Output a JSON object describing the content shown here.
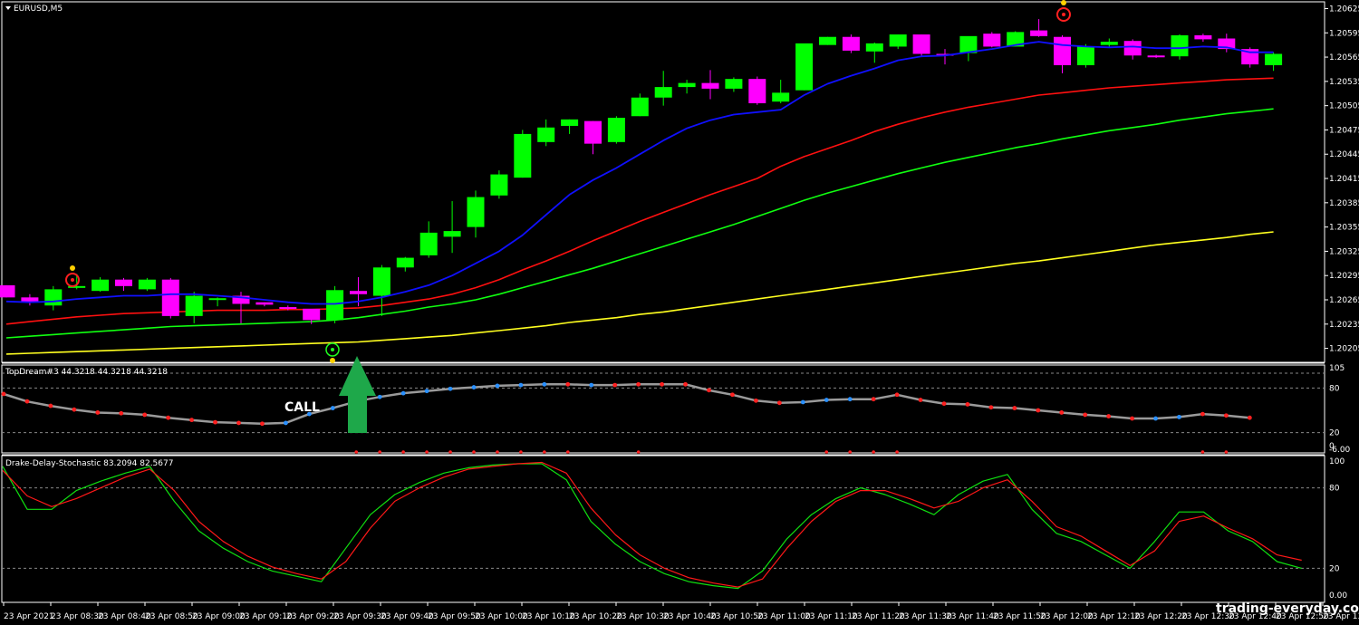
{
  "chart_title": "EURUSD,M5",
  "topdream_label": "TopDream#3 44.3218 44.3218 44.3218",
  "stoch_label": "Drake-Delay-Stochastic 83.2094 82.5677",
  "call_label": "CALL",
  "watermark": "trading-everyday.com",
  "colors": {
    "background": "#000000",
    "bull": "#00ff00",
    "bear": "#ff00ff",
    "ema_blue": "#1010ff",
    "ema_red": "#ff1010",
    "ema_green": "#10ff10",
    "ema_yellow": "#ffff20",
    "arrow": "#1ea84a",
    "dream_line": "#9a9a9a",
    "dot_red": "#ff2020",
    "dot_blue": "#2a90ff",
    "stoch_green": "#10e010",
    "stoch_red": "#ff1818"
  },
  "chart_data": [
    {
      "type": "candlestick",
      "title": "EURUSD,M5",
      "ylim": [
        1.2019,
        1.2063
      ],
      "y_ticks": [
        "1.20625",
        "1.20595",
        "1.20565",
        "1.20535",
        "1.20505",
        "1.20475",
        "1.20445",
        "1.20415",
        "1.20385",
        "1.20355",
        "1.20325",
        "1.20295",
        "1.20265",
        "1.20235",
        "1.20205"
      ],
      "x_ticks": [
        "23 Apr 2021",
        "23 Apr 08:30",
        "23 Apr 08:40",
        "23 Apr 08:50",
        "23 Apr 09:00",
        "23 Apr 09:10",
        "23 Apr 09:20",
        "23 Apr 09:30",
        "23 Apr 09:40",
        "23 Apr 09:50",
        "23 Apr 10:00",
        "23 Apr 10:10",
        "23 Apr 10:20",
        "23 Apr 10:30",
        "23 Apr 10:40",
        "23 Apr 10:50",
        "23 Apr 11:00",
        "23 Apr 11:10",
        "23 Apr 11:20",
        "23 Apr 11:30",
        "23 Apr 11:40",
        "23 Apr 11:50",
        "23 Apr 12:00",
        "23 Apr 12:10",
        "23 Apr 12:20",
        "23 Apr 12:30",
        "23 Apr 12:40",
        "23 Apr 12:50",
        "23 Apr 13:00"
      ],
      "candles": [
        [
          1.20283,
          1.20283,
          1.20268,
          1.20268
        ],
        [
          1.20268,
          1.20272,
          1.20258,
          1.20262
        ],
        [
          1.20258,
          1.20282,
          1.20252,
          1.20278
        ],
        [
          1.2028,
          1.20297,
          1.20278,
          1.20282
        ],
        [
          1.20276,
          1.20293,
          1.20275,
          1.2029
        ],
        [
          1.2029,
          1.20292,
          1.20276,
          1.20282
        ],
        [
          1.20278,
          1.20292,
          1.20276,
          1.2029
        ],
        [
          1.2029,
          1.20292,
          1.20242,
          1.20245
        ],
        [
          1.20245,
          1.20275,
          1.20236,
          1.2027
        ],
        [
          1.20265,
          1.20268,
          1.20257,
          1.20267
        ],
        [
          1.2027,
          1.20275,
          1.20236,
          1.2026
        ],
        [
          1.20262,
          1.20262,
          1.20257,
          1.20259
        ],
        [
          1.20256,
          1.20258,
          1.20252,
          1.20255
        ],
        [
          1.20254,
          1.20252,
          1.20235,
          1.2024
        ],
        [
          1.2024,
          1.20282,
          1.20236,
          1.20277
        ],
        [
          1.20276,
          1.20293,
          1.20257,
          1.20272
        ],
        [
          1.2027,
          1.20308,
          1.20245,
          1.20305
        ],
        [
          1.20305,
          1.20318,
          1.203,
          1.20317
        ],
        [
          1.2032,
          1.20362,
          1.20317,
          1.20348
        ],
        [
          1.20343,
          1.20387,
          1.20323,
          1.2035
        ],
        [
          1.20355,
          1.204,
          1.20342,
          1.20392
        ],
        [
          1.20394,
          1.20425,
          1.2039,
          1.2042
        ],
        [
          1.20416,
          1.20475,
          1.20416,
          1.2047
        ],
        [
          1.2046,
          1.20488,
          1.20455,
          1.20478
        ],
        [
          1.2048,
          1.20488,
          1.2047,
          1.20488
        ],
        [
          1.20486,
          1.20486,
          1.20445,
          1.20458
        ],
        [
          1.2046,
          1.20492,
          1.20458,
          1.2049
        ],
        [
          1.20492,
          1.2052,
          1.20492,
          1.20515
        ],
        [
          1.20515,
          1.20548,
          1.20505,
          1.20528
        ],
        [
          1.20528,
          1.20537,
          1.2052,
          1.20533
        ],
        [
          1.20533,
          1.20549,
          1.20513,
          1.20526
        ],
        [
          1.20526,
          1.2054,
          1.20522,
          1.20538
        ],
        [
          1.20538,
          1.20541,
          1.20506,
          1.20508
        ],
        [
          1.2051,
          1.20537,
          1.20508,
          1.20521
        ],
        [
          1.20524,
          1.20581,
          1.20524,
          1.20582
        ],
        [
          1.2058,
          1.2059,
          1.2058,
          1.2059
        ],
        [
          1.2059,
          1.20593,
          1.2057,
          1.20573
        ],
        [
          1.20572,
          1.20583,
          1.20558,
          1.20582
        ],
        [
          1.20578,
          1.20593,
          1.20575,
          1.20593
        ],
        [
          1.20593,
          1.20593,
          1.20565,
          1.20569
        ],
        [
          1.20569,
          1.20575,
          1.20556,
          1.20568
        ],
        [
          1.2057,
          1.2059,
          1.2056,
          1.20591
        ],
        [
          1.20594,
          1.20596,
          1.20577,
          1.20578
        ],
        [
          1.20578,
          1.20597,
          1.20578,
          1.20596
        ],
        [
          1.20598,
          1.20612,
          1.2059,
          1.20591
        ],
        [
          1.2059,
          1.20592,
          1.20545,
          1.20555
        ],
        [
          1.20555,
          1.20581,
          1.20552,
          1.20578
        ],
        [
          1.2058,
          1.20588,
          1.20577,
          1.20584
        ],
        [
          1.20585,
          1.20587,
          1.20562,
          1.20567
        ],
        [
          1.20567,
          1.20568,
          1.20564,
          1.20566
        ],
        [
          1.20566,
          1.20593,
          1.20562,
          1.20592
        ],
        [
          1.20592,
          1.20594,
          1.20584,
          1.20587
        ],
        [
          1.20588,
          1.20594,
          1.20571,
          1.20575
        ],
        [
          1.20575,
          1.20577,
          1.20552,
          1.20556
        ],
        [
          1.20555,
          1.20571,
          1.20548,
          1.20569
        ]
      ],
      "ma_blue": [
        1.20263,
        1.20262,
        1.20263,
        1.20266,
        1.20268,
        1.2027,
        1.2027,
        1.20272,
        1.20272,
        1.2027,
        1.20268,
        1.20265,
        1.20262,
        1.2026,
        1.2026,
        1.20263,
        1.20268,
        1.20275,
        1.20283,
        1.20295,
        1.2031,
        1.20325,
        1.20345,
        1.2037,
        1.20395,
        1.20413,
        1.20428,
        1.20445,
        1.20462,
        1.20477,
        1.20487,
        1.20494,
        1.20497,
        1.205,
        1.20518,
        1.20532,
        1.20542,
        1.20551,
        1.20561,
        1.20566,
        1.20567,
        1.20571,
        1.20575,
        1.2058,
        1.20584,
        1.2058,
        1.20578,
        1.20577,
        1.20578,
        1.20576,
        1.20576,
        1.20578,
        1.20577,
        1.20571,
        1.20571
      ],
      "ma_red": [
        1.20235,
        1.20238,
        1.20241,
        1.20244,
        1.20246,
        1.20248,
        1.20249,
        1.2025,
        1.20251,
        1.20252,
        1.20252,
        1.20252,
        1.20253,
        1.20253,
        1.20254,
        1.20255,
        1.20258,
        1.20262,
        1.20266,
        1.20272,
        1.2028,
        1.2029,
        1.20302,
        1.20313,
        1.20325,
        1.20338,
        1.2035,
        1.20362,
        1.20373,
        1.20384,
        1.20395,
        1.20405,
        1.20415,
        1.2043,
        1.20442,
        1.20452,
        1.20462,
        1.20473,
        1.20482,
        1.2049,
        1.20497,
        1.20503,
        1.20508,
        1.20513,
        1.20518,
        1.20521,
        1.20524,
        1.20527,
        1.20529,
        1.20531,
        1.20533,
        1.20535,
        1.20537,
        1.20538,
        1.20539
      ],
      "ma_green": [
        1.20218,
        1.2022,
        1.20222,
        1.20224,
        1.20226,
        1.20228,
        1.2023,
        1.20232,
        1.20233,
        1.20234,
        1.20235,
        1.20236,
        1.20237,
        1.20238,
        1.2024,
        1.20243,
        1.20247,
        1.20251,
        1.20256,
        1.2026,
        1.20265,
        1.20272,
        1.2028,
        1.20288,
        1.20296,
        1.20304,
        1.20313,
        1.20322,
        1.20331,
        1.2034,
        1.20349,
        1.20358,
        1.20368,
        1.20378,
        1.20388,
        1.20397,
        1.20405,
        1.20413,
        1.20421,
        1.20428,
        1.20435,
        1.20441,
        1.20447,
        1.20453,
        1.20458,
        1.20464,
        1.20469,
        1.20474,
        1.20478,
        1.20482,
        1.20487,
        1.20491,
        1.20495,
        1.20498,
        1.20501
      ],
      "ma_yellow": [
        1.20198,
        1.20199,
        1.202,
        1.20201,
        1.20202,
        1.20203,
        1.20204,
        1.20205,
        1.20206,
        1.20207,
        1.20208,
        1.20209,
        1.2021,
        1.20211,
        1.20212,
        1.20213,
        1.20215,
        1.20217,
        1.20219,
        1.20221,
        1.20224,
        1.20227,
        1.2023,
        1.20233,
        1.20237,
        1.2024,
        1.20243,
        1.20247,
        1.2025,
        1.20254,
        1.20258,
        1.20262,
        1.20266,
        1.2027,
        1.20274,
        1.20278,
        1.20282,
        1.20286,
        1.2029,
        1.20294,
        1.20298,
        1.20302,
        1.20306,
        1.2031,
        1.20313,
        1.20317,
        1.20321,
        1.20325,
        1.20329,
        1.20333,
        1.20336,
        1.20339,
        1.20342,
        1.20346,
        1.20349
      ]
    },
    {
      "type": "line",
      "title": "TopDream#3 44.3218 44.3218 44.3218",
      "ylim": [
        0,
        100
      ],
      "y_ticks": [
        "105",
        "80",
        "20",
        "0",
        "-6.00"
      ],
      "levels": [
        80,
        20
      ],
      "values": [
        72,
        62,
        56,
        51,
        47,
        46,
        44,
        40,
        37,
        34,
        33,
        32,
        33,
        45,
        53,
        62,
        68,
        73,
        76,
        79,
        81,
        83,
        84,
        85,
        85,
        84,
        84,
        85,
        85,
        85,
        77,
        71,
        63,
        60,
        61,
        64,
        65,
        65,
        71,
        64,
        59,
        58,
        54,
        53,
        50,
        47,
        44,
        42,
        39,
        39,
        41,
        45,
        43,
        40
      ],
      "dot_colors": [
        "red",
        "red",
        "red",
        "red",
        "red",
        "red",
        "red",
        "red",
        "red",
        "red",
        "red",
        "red",
        "blue",
        "blue",
        "blue",
        "blue",
        "blue",
        "blue",
        "blue",
        "blue",
        "blue",
        "blue",
        "blue",
        "blue",
        "red",
        "blue",
        "red",
        "red",
        "red",
        "red",
        "red",
        "red",
        "red",
        "red",
        "blue",
        "blue",
        "blue",
        "red",
        "red",
        "red",
        "red",
        "red",
        "red",
        "red",
        "red",
        "red",
        "red",
        "red",
        "red",
        "blue",
        "blue",
        "red",
        "red",
        "red"
      ]
    },
    {
      "type": "line",
      "title": "Drake-Delay-Stochastic 83.2094 82.5677",
      "ylim": [
        0,
        100
      ],
      "y_ticks": [
        "100",
        "80",
        "20",
        "0.00"
      ],
      "levels": [
        80,
        20
      ],
      "series": [
        {
          "color": "green",
          "values": [
            96,
            64,
            64,
            78,
            85,
            91,
            96,
            70,
            48,
            35,
            25,
            18,
            14,
            10,
            35,
            60,
            75,
            84,
            91,
            95,
            97,
            98,
            98,
            86,
            55,
            38,
            25,
            16,
            10,
            7,
            5,
            18,
            42,
            60,
            72,
            80,
            75,
            68,
            60,
            75,
            85,
            90,
            64,
            46,
            40,
            30,
            20,
            40,
            62,
            62,
            48,
            40,
            25,
            20
          ]
        },
        {
          "color": "red",
          "values": [
            93,
            74,
            66,
            72,
            80,
            88,
            94,
            78,
            55,
            40,
            29,
            21,
            16,
            12,
            25,
            50,
            70,
            80,
            88,
            94,
            96,
            98,
            99,
            91,
            65,
            45,
            30,
            20,
            13,
            9,
            6,
            12,
            35,
            55,
            70,
            78,
            78,
            72,
            65,
            70,
            80,
            86,
            70,
            51,
            44,
            33,
            22,
            33,
            55,
            59,
            50,
            42,
            30,
            26
          ]
        }
      ]
    }
  ]
}
